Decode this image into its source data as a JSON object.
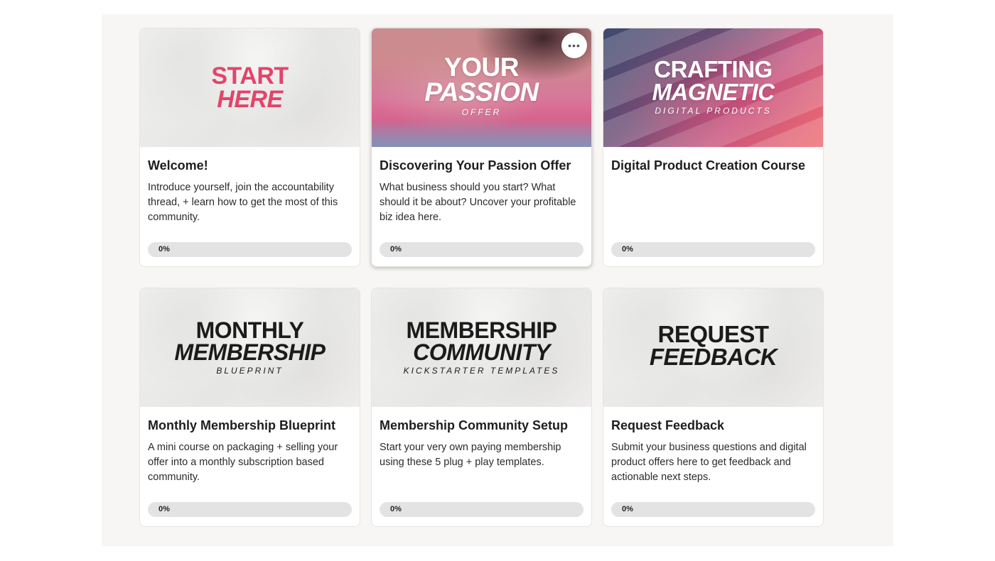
{
  "courses": [
    {
      "thumb": {
        "lines": [
          "START",
          "HERE"
        ],
        "sub": ""
      },
      "title": "Welcome!",
      "description": "Introduce yourself, join the accountability thread, + learn how to get the most of this community.",
      "progress_label": "0%",
      "progress": 0
    },
    {
      "thumb": {
        "lines": [
          "YOUR",
          "PASSION"
        ],
        "sub": "OFFER"
      },
      "title": "Discovering Your Passion Offer",
      "description": "What business should you start? What should it be about? Uncover your profitable biz idea here.",
      "progress_label": "0%",
      "progress": 0,
      "more_icon": "more-horizontal-icon"
    },
    {
      "thumb": {
        "lines": [
          "CRAFTING",
          "MAGNETIC"
        ],
        "sub": "DIGITAL PRODUCTS"
      },
      "title": "Digital Product Creation Course",
      "description": "",
      "progress_label": "0%",
      "progress": 0
    },
    {
      "thumb": {
        "lines": [
          "MONTHLY",
          "MEMBERSHIP"
        ],
        "sub": "BLUEPRINT"
      },
      "title": "Monthly Membership Blueprint",
      "description": "A mini course on packaging + selling your offer into a monthly subscription based community.",
      "progress_label": "0%",
      "progress": 0
    },
    {
      "thumb": {
        "lines": [
          "MEMBERSHIP",
          "COMMUNITY"
        ],
        "sub": "KICKSTARTER TEMPLATES"
      },
      "title": "Membership Community Setup",
      "description": "Start your very own paying membership using these 5 plug + play templates.",
      "progress_label": "0%",
      "progress": 0
    },
    {
      "thumb": {
        "lines": [
          "REQUEST",
          "FEEDBACK"
        ],
        "sub": ""
      },
      "title": "Request Feedback",
      "description": "Submit your business questions and digital product offers here to get feedback and actionable next steps.",
      "progress_label": "0%",
      "progress": 0
    }
  ],
  "colors": {
    "accent_pink": "#e2456a",
    "progress_track": "#e3e3e3",
    "background": "#f7f6f4"
  }
}
